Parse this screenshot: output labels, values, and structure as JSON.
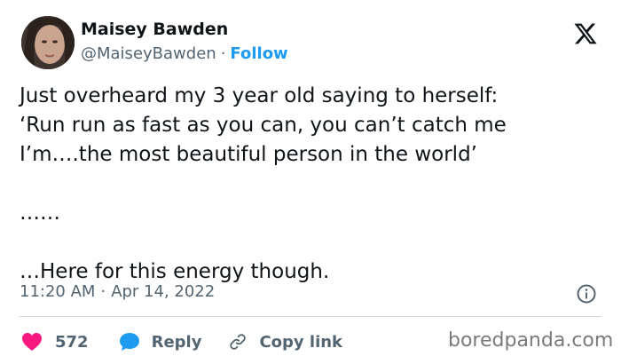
{
  "author": {
    "name": "Maisey Bawden",
    "handle": "@MaiseyBawden",
    "separator": "·",
    "follow_label": "Follow"
  },
  "tweet": {
    "lines": [
      "Just overheard my 3 year old saying to herself:",
      "‘Run run as fast as you can, you can’t catch me",
      "I’m….the most beautiful person in the world’",
      "",
      "……",
      "",
      "…Here for this energy though."
    ],
    "time": "11:20 AM",
    "date_separator": "·",
    "date": "Apr 14, 2022"
  },
  "actions": {
    "like_count": "572",
    "reply_label": "Reply",
    "copy_link_label": "Copy link"
  },
  "icons": {
    "logo": "x-logo-icon",
    "info": "info-icon",
    "like": "heart-icon",
    "reply": "speech-bubble-icon",
    "copy": "link-icon"
  },
  "colors": {
    "follow": "#1d9bf0",
    "heart": "#f91880",
    "reply_bubble": "#1d9bf0",
    "secondary_text": "#536471"
  },
  "watermark": "boredpanda.com"
}
